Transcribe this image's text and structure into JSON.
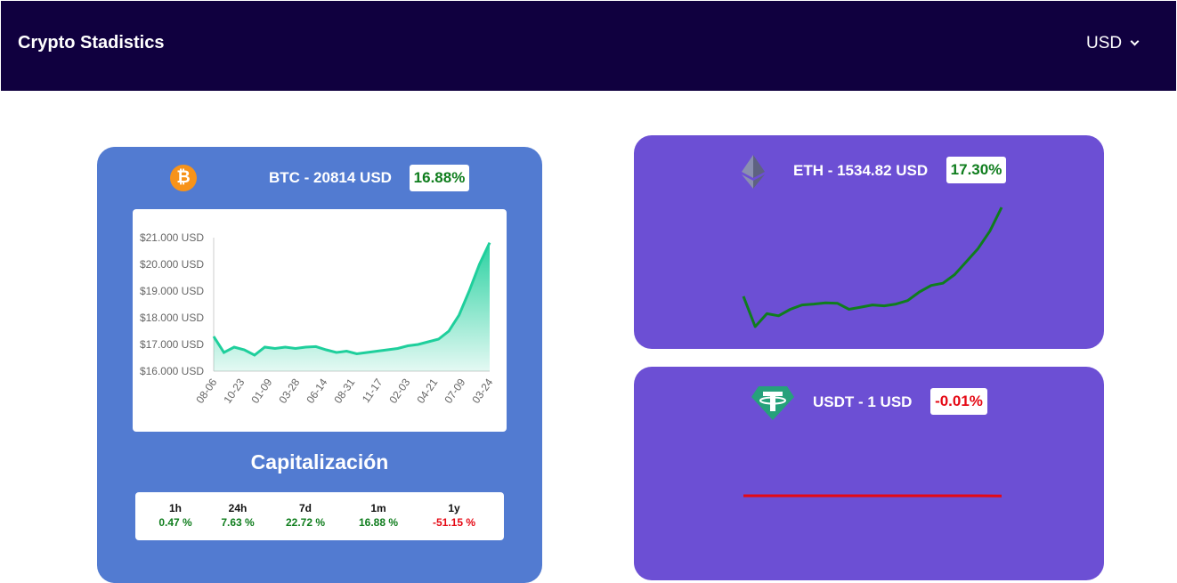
{
  "header": {
    "title": "Crypto Stadistics",
    "currency": "USD"
  },
  "colors": {
    "header_bg": "#10003f",
    "btc_card": "#527bd1",
    "alt_card": "#6c4fd4",
    "positive": "#0f7d1d",
    "negative": "#e50914",
    "area_line": "#1fcf9c"
  },
  "btc": {
    "icon": "bitcoin-icon",
    "icon_glyph": "₿",
    "title": "BTC - 20814 USD",
    "change": "16.88%",
    "cap_title": "Capitalización",
    "cap": [
      {
        "label": "1h",
        "value": "0.47 %",
        "positive": true
      },
      {
        "label": "24h",
        "value": "7.63 %",
        "positive": true
      },
      {
        "label": "7d",
        "value": "22.72 %",
        "positive": true
      },
      {
        "label": "1m",
        "value": "16.88 %",
        "positive": true
      },
      {
        "label": "1y",
        "value": "-51.15 %",
        "positive": false
      }
    ]
  },
  "eth": {
    "icon": "ethereum-icon",
    "title": "ETH - 1534.82 USD",
    "change": "17.30%"
  },
  "usdt": {
    "icon": "tether-icon",
    "title": "USDT - 1 USD",
    "change": "-0.01%"
  },
  "chart_data": [
    {
      "type": "area",
      "title": "",
      "xlabel": "",
      "ylabel": "",
      "x_ticks": [
        "08-06",
        "10-23",
        "01-09",
        "03-28",
        "06-14",
        "08-31",
        "11-17",
        "02-03",
        "04-21",
        "07-09",
        "03-24"
      ],
      "y_ticks": [
        "$16.000 USD",
        "$17.000 USD",
        "$18.000 USD",
        "$19.000 USD",
        "$20.000 USD",
        "$21.000 USD"
      ],
      "ylim": [
        16000,
        21000
      ],
      "series": [
        {
          "values": [
            17300,
            16700,
            16900,
            16800,
            16600,
            16900,
            16850,
            16900,
            16850,
            16900,
            16920,
            16800,
            16700,
            16750,
            16650,
            16700,
            16750,
            16800,
            16850,
            16950,
            17000,
            17100,
            17200,
            17500,
            18100,
            19000,
            20000,
            20814
          ]
        }
      ]
    },
    {
      "type": "line",
      "series": [
        {
          "values": [
            1330,
            1260,
            1290,
            1285,
            1300,
            1310,
            1312,
            1315,
            1314,
            1300,
            1305,
            1310,
            1308,
            1312,
            1320,
            1340,
            1355,
            1360,
            1380,
            1410,
            1440,
            1480,
            1534.82
          ]
        }
      ]
    },
    {
      "type": "line",
      "series": [
        {
          "values": [
            1.0,
            1.0,
            1.0,
            1.0,
            1.0,
            1.0,
            1.0,
            1.0,
            1.0,
            1.0,
            1.0,
            0.9999
          ]
        }
      ]
    }
  ]
}
